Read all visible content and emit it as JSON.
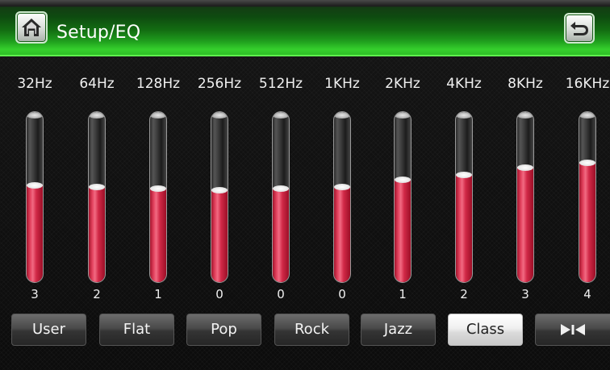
{
  "header": {
    "title": "Setup/EQ",
    "home_icon": "home-icon",
    "back_icon": "back-arrow-icon"
  },
  "eq": {
    "bands": [
      {
        "freq": "32Hz",
        "level": "3",
        "fill": 0.57
      },
      {
        "freq": "64Hz",
        "level": "2",
        "fill": 0.56
      },
      {
        "freq": "128Hz",
        "level": "1",
        "fill": 0.55
      },
      {
        "freq": "256Hz",
        "level": "0",
        "fill": 0.54
      },
      {
        "freq": "512Hz",
        "level": "0",
        "fill": 0.55
      },
      {
        "freq": "1KHz",
        "level": "0",
        "fill": 0.56
      },
      {
        "freq": "2KHz",
        "level": "1",
        "fill": 0.6
      },
      {
        "freq": "4KHz",
        "level": "2",
        "fill": 0.63
      },
      {
        "freq": "8KHz",
        "level": "3",
        "fill": 0.67
      },
      {
        "freq": "16KHz",
        "level": "4",
        "fill": 0.7
      }
    ]
  },
  "presets": {
    "items": [
      {
        "label": "User"
      },
      {
        "label": "Flat"
      },
      {
        "label": "Pop"
      },
      {
        "label": "Rock"
      },
      {
        "label": "Jazz"
      },
      {
        "label": "Class"
      }
    ],
    "active_index": 5,
    "balance_icon": "balance-icon"
  },
  "colors": {
    "header_green": "#1f9d1d",
    "accent_green": "#5ef04d",
    "slider_fill": "#d12947"
  }
}
